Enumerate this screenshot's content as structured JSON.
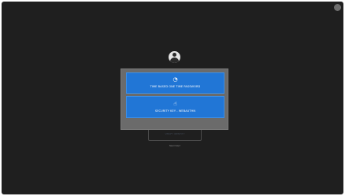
{
  "login": {
    "primary_button": "VERIFY IDENTITY",
    "secondary_link": "Need help?"
  },
  "mfa_dialog": {
    "options": [
      {
        "label": "TIME BASED ONE TIME PASSWORD",
        "icon": "clock-icon"
      },
      {
        "label": "SECURITY KEY - WEBAUTHN",
        "icon": "hand-pointer-icon"
      }
    ]
  },
  "colors": {
    "background": "#1f1f1f",
    "dialog": "#6b6b6b",
    "option_button": "#2176d6"
  }
}
